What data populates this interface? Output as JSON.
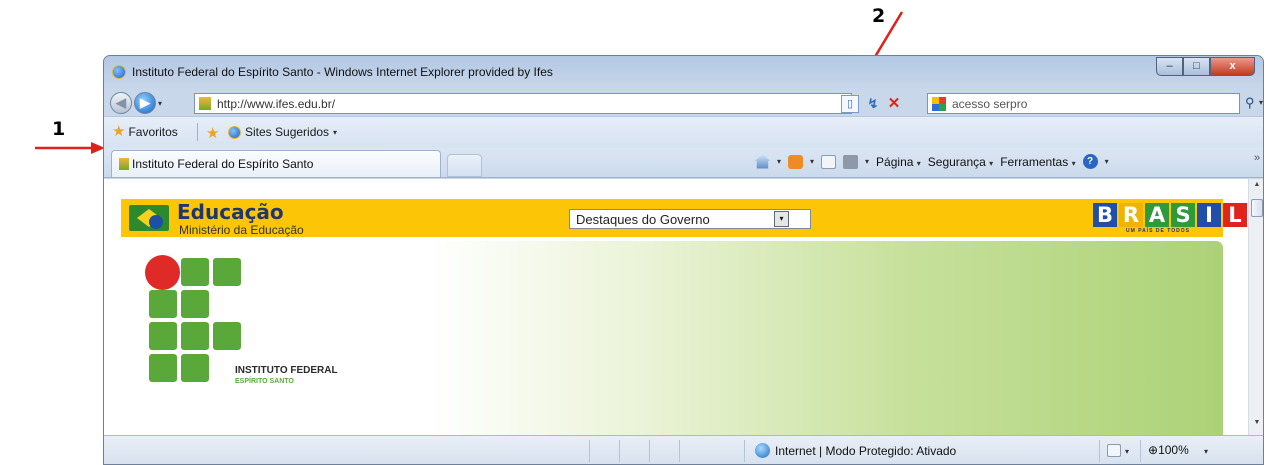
{
  "annotations": {
    "label_1": "1",
    "label_2": "2",
    "arrow_color": "#e0201a"
  },
  "window": {
    "title": "Instituto Federal do Espírito Santo - Windows Internet Explorer provided by Ifes",
    "controls": {
      "minimize": "–",
      "maximize": "□",
      "close": "x"
    }
  },
  "navbar": {
    "back": "◀",
    "forward": "▶",
    "dropdown": "▾",
    "address": "http://www.ifes.edu.br/",
    "compat_icon": "compatibility-view-icon",
    "compat_glyph": "▯",
    "refresh_glyph": "↯",
    "stop_glyph": "✕",
    "search_placeholder": "acesso serpro",
    "search_glyph": "⚲"
  },
  "favorites_bar": {
    "favorites_label": "Favoritos",
    "add_glyph": "★",
    "star_glyph": "★",
    "sites_label": "Sites Sugeridos",
    "sites_dropdown": "▾"
  },
  "tabs": [
    {
      "label": "Instituto Federal do Espírito Santo",
      "active": true
    }
  ],
  "command_bar": {
    "page_label": "Página",
    "security_label": "Segurança",
    "tools_label": "Ferramentas",
    "help_glyph": "?",
    "dd": "▾",
    "overflow": "»"
  },
  "gov_bar": {
    "title": "Educação",
    "subtitle": "Ministério da Educação",
    "select_value": "Destaques do Governo",
    "select_arrow": "▾",
    "brasil_letters": [
      "B",
      "R",
      "A",
      "S",
      "I",
      "L"
    ],
    "brasil_colors": [
      "#1f4fa8",
      "#f0b400",
      "#2f9a3a",
      "#2f9a3a",
      "#1f4fa8",
      "#e0231c"
    ],
    "brasil_tagline": "UM PAÍS DE TODOS",
    "bar_color": "#fcc506"
  },
  "banner": {
    "institute_name": "INSTITUTO FEDERAL",
    "institute_sub": "ESPÍRITO SANTO",
    "logo_colors": {
      "square": "#5aa83a",
      "dot": "#e02a27"
    }
  },
  "scrollbar": {
    "up": "▲",
    "down": "▼"
  },
  "status_bar": {
    "zone_text": "Internet | Modo Protegido: Ativado",
    "zoom_text": "100%",
    "zoom_prefix": "⊕",
    "dd": "▾"
  }
}
